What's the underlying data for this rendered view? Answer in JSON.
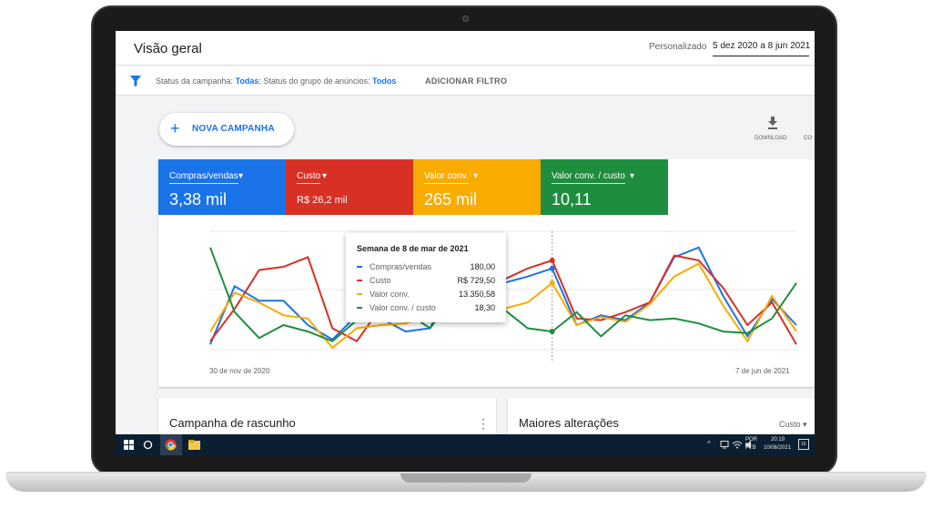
{
  "header": {
    "title": "Visão geral",
    "date_label": "Personalizado",
    "date_range": "5 dez 2020 a 8 jun 2021"
  },
  "filter": {
    "campaign_status_label": "Status da campanha: ",
    "campaign_status_value": "Todas",
    "separator": "; ",
    "adgroup_status_label": "Status do grupo de anúncios: ",
    "adgroup_status_value": "Todos",
    "add_filter": "ADICIONAR FILTRO"
  },
  "toolbar": {
    "new_campaign": "NOVA CAMPANHA",
    "download": "DOWNLOAD",
    "cor": "CO"
  },
  "metrics": [
    {
      "name": "Compras/vendas",
      "value": "3,38 mil",
      "color": "#1a73e8"
    },
    {
      "name": "Custo",
      "value": "R$ 26,2 mil",
      "color": "#d93025"
    },
    {
      "name": "Valor conv.",
      "value": "265 mil",
      "color": "#f9ab00"
    },
    {
      "name": "Valor conv. / custo",
      "value": "10,11",
      "color": "#1e8e3e"
    }
  ],
  "chart_data": {
    "type": "line",
    "x_start_label": "30 de nov de 2020",
    "x_end_label": "7 de jun de 2021",
    "series": [
      {
        "name": "Compras/vendas",
        "color": "#1a73e8",
        "values": [
          10,
          46,
          37,
          37,
          22,
          13,
          28,
          26,
          18,
          20,
          52,
          70,
          48,
          52,
          57,
          22,
          28,
          25,
          36,
          64,
          70,
          40,
          15,
          38,
          22
        ]
      },
      {
        "name": "Custo",
        "color": "#d93025",
        "values": [
          12,
          32,
          56,
          58,
          64,
          20,
          12,
          33,
          48,
          53,
          50,
          72,
          50,
          57,
          62,
          26,
          25,
          30,
          36,
          65,
          62,
          45,
          22,
          36,
          10
        ]
      },
      {
        "name": "Valor conv.",
        "color": "#f9ab00",
        "values": [
          18,
          42,
          36,
          28,
          26,
          8,
          20,
          22,
          23,
          28,
          38,
          65,
          32,
          36,
          48,
          22,
          27,
          24,
          35,
          52,
          60,
          34,
          12,
          40,
          18
        ]
      },
      {
        "name": "Valor conv. / custo",
        "color": "#1e8e3e",
        "values": [
          70,
          30,
          14,
          22,
          18,
          12,
          25,
          26,
          30,
          20,
          40,
          37,
          32,
          20,
          18,
          30,
          15,
          28,
          25,
          26,
          23,
          18,
          17,
          26,
          48
        ]
      }
    ]
  },
  "tooltip": {
    "title": "Semana de 8 de mar de 2021",
    "rows": [
      {
        "name": "Compras/vendas",
        "value": "180,00",
        "color": "#1a73e8"
      },
      {
        "name": "Custo",
        "value": "R$ 729,50",
        "color": "#d93025"
      },
      {
        "name": "Valor conv.",
        "value": "13.350,58",
        "color": "#f9ab00"
      },
      {
        "name": "Valor conv. / custo",
        "value": "18,30",
        "color": "#1e8e3e"
      }
    ]
  },
  "bottom": {
    "draft_title": "Campanha de rascunho",
    "changes_title": "Maiores alterações",
    "changes_select": "Custo"
  },
  "taskbar": {
    "lang_top": "POR",
    "lang_bottom": "PTB",
    "time": "20:19",
    "date": "10/06/2021",
    "notifications": "15"
  }
}
